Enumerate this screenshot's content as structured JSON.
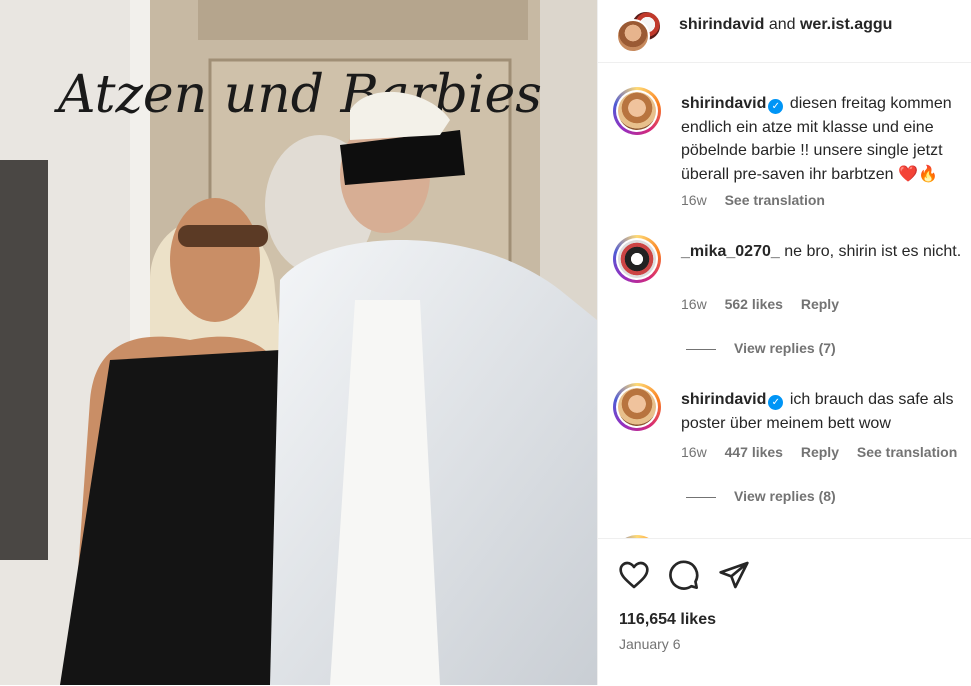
{
  "post_image": {
    "title_script": "Atzen und Barbies"
  },
  "header": {
    "user1": "shirindavid",
    "connector": "and",
    "user2": "wer.ist.aggu"
  },
  "comments": [
    {
      "username": "shirindavid",
      "verified": true,
      "text": "diesen freitag kommen endlich ein atze mit klasse und eine pöbelnde barbie !! unsere single jetzt überall pre-saven ihr barbtzen",
      "emoji": "❤️🔥",
      "time": "16w",
      "translate": "See translation"
    },
    {
      "username": "_mika_0270_",
      "text": "ne bro, shirin ist es nicht.",
      "time": "16w",
      "likes": "562 likes",
      "reply": "Reply",
      "view_replies": "View replies (7)"
    },
    {
      "username": "shirindavid",
      "verified": true,
      "text": "ich brauch das safe als poster über meinem bett wow",
      "time": "16w",
      "likes": "447 likes",
      "reply": "Reply",
      "translate": "See translation",
      "view_replies": "View replies (8)"
    }
  ],
  "actions": {
    "like_icon": "heart-icon",
    "comment_icon": "comment-icon",
    "share_icon": "send-icon"
  },
  "likes_count": "116,654 likes",
  "post_date": "January 6"
}
